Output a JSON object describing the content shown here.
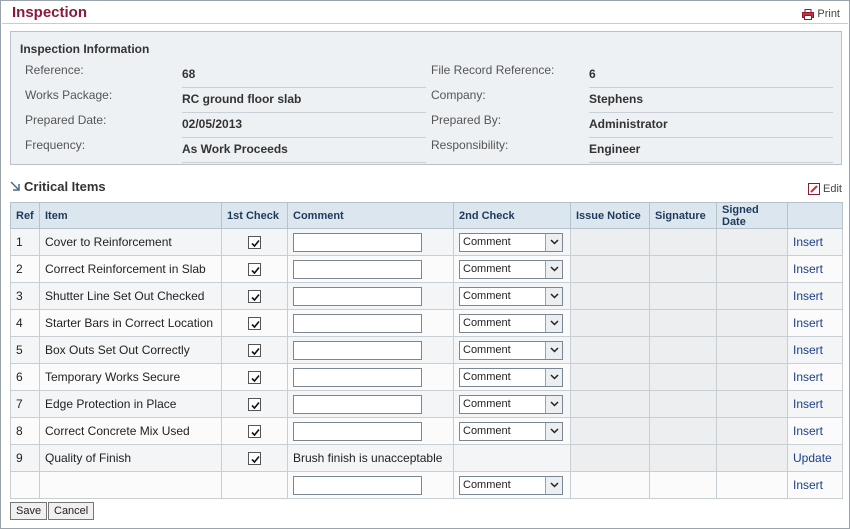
{
  "page": {
    "title": "Inspection",
    "print_label": "Print"
  },
  "info": {
    "heading": "Inspection Information",
    "left": [
      {
        "label": "Reference:",
        "value": "68"
      },
      {
        "label": "Works Package:",
        "value": "RC ground floor slab"
      },
      {
        "label": "Prepared Date:",
        "value": "02/05/2013"
      },
      {
        "label": "Frequency:",
        "value": "As Work Proceeds"
      }
    ],
    "right": [
      {
        "label": "File Record Reference:",
        "value": "6"
      },
      {
        "label": "Company:",
        "value": "Stephens"
      },
      {
        "label": "Prepared By:",
        "value": "Administrator"
      },
      {
        "label": "Responsibility:",
        "value": "Engineer"
      }
    ]
  },
  "critical": {
    "title": "Critical Items",
    "edit_label": "Edit"
  },
  "table": {
    "headers": [
      "Ref",
      "Item",
      "1st Check",
      "Comment",
      "2nd Check",
      "Issue Notice",
      "Signature",
      "Signed Date",
      ""
    ],
    "rows": [
      {
        "ref": "1",
        "item": "Cover to Reinforcement",
        "checked": true,
        "comment": "",
        "second": "Comment",
        "action": "Insert"
      },
      {
        "ref": "2",
        "item": "Correct Reinforcement in Slab",
        "checked": true,
        "comment": "",
        "second": "Comment",
        "action": "Insert"
      },
      {
        "ref": "3",
        "item": "Shutter Line Set Out Checked",
        "checked": true,
        "comment": "",
        "second": "Comment",
        "action": "Insert"
      },
      {
        "ref": "4",
        "item": "Starter Bars in Correct Location",
        "checked": true,
        "comment": "",
        "second": "Comment",
        "action": "Insert"
      },
      {
        "ref": "5",
        "item": "Box Outs Set Out Correctly",
        "checked": true,
        "comment": "",
        "second": "Comment",
        "action": "Insert"
      },
      {
        "ref": "6",
        "item": "Temporary Works Secure",
        "checked": true,
        "comment": "",
        "second": "Comment",
        "action": "Insert"
      },
      {
        "ref": "7",
        "item": "Edge Protection in Place",
        "checked": true,
        "comment": "",
        "second": "Comment",
        "action": "Insert"
      },
      {
        "ref": "8",
        "item": "Correct Concrete Mix Used",
        "checked": true,
        "comment": "",
        "second": "Comment",
        "action": "Insert"
      },
      {
        "ref": "9",
        "item": "Quality of Finish",
        "checked": true,
        "comment": "Brush finish is unacceptable",
        "second": "",
        "action": "Update"
      },
      {
        "ref": "",
        "item": "",
        "checked": false,
        "comment": "",
        "second": "Comment",
        "action": "Insert"
      }
    ]
  },
  "buttons": {
    "save": "Save",
    "cancel": "Cancel"
  },
  "colors": {
    "title": "#8b1a3a",
    "link": "#1c3f86",
    "header_bg": "#dce6ef",
    "panel_bg": "#eef1f4"
  }
}
